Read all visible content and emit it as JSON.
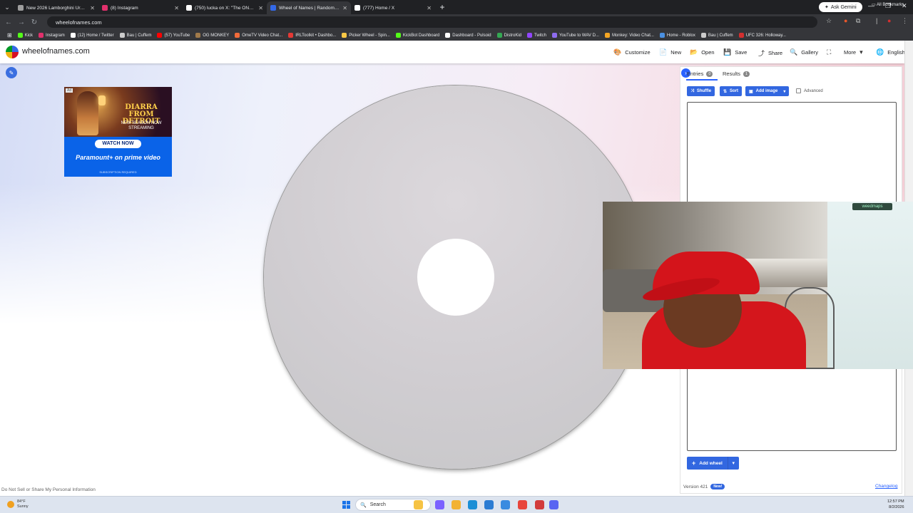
{
  "browser": {
    "tabs": [
      {
        "title": "New 2026 Lamborghini Urus SE",
        "color": "#9e9e9e",
        "active": false
      },
      {
        "title": "(8) Instagram",
        "color": "#e1306c",
        "active": false
      },
      {
        "title": "(750) lucka on X: \"The ONLY thi",
        "color": "#ffffff",
        "active": false
      },
      {
        "title": "Wheel of Names | Random nam",
        "color": "#3369e8",
        "active": true
      },
      {
        "title": "(777) Home / X",
        "color": "#ffffff",
        "active": false
      }
    ],
    "new_tab": "+",
    "gemini_label": "Ask Gemini",
    "url": "wheelofnames.com",
    "bookmarks": [
      {
        "label": "Kick",
        "color": "#53fc18"
      },
      {
        "label": "Instagram",
        "color": "#e1306c"
      },
      {
        "label": "(12) Home / Twitter",
        "color": "#ffffff"
      },
      {
        "label": "Bau | Cuffem",
        "color": "#cccccc"
      },
      {
        "label": "(57) YouTube",
        "color": "#ff0000"
      },
      {
        "label": "OG MONKEY",
        "color": "#a07a4a"
      },
      {
        "label": "OmeTV Video Chat...",
        "color": "#f26b3a"
      },
      {
        "label": "IRLToolkit • Dashbo...",
        "color": "#e53935"
      },
      {
        "label": "Picker Wheel - Spin...",
        "color": "#f9c846"
      },
      {
        "label": "KickBot Dashboard",
        "color": "#53fc18"
      },
      {
        "label": "Dashboard - Pulsoid",
        "color": "#ffffff"
      },
      {
        "label": "DistroKid",
        "color": "#34a853"
      },
      {
        "label": "Twitch",
        "color": "#9146ff"
      },
      {
        "label": "YouTube to WAV D...",
        "color": "#8e6cf0"
      },
      {
        "label": "Monkey: Video Chat...",
        "color": "#f5a623"
      },
      {
        "label": "Home - Roblox",
        "color": "#4a90e2"
      },
      {
        "label": "Bau | Cuffem",
        "color": "#cccccc"
      },
      {
        "label": "UFC 326: Holloway...",
        "color": "#d32f2f"
      }
    ],
    "all_bookmarks": "All Bookmarks"
  },
  "site": {
    "title": "wheelofnames.com",
    "menu": [
      {
        "label": "Customize",
        "icon": "palette-icon",
        "glyph": "🎨"
      },
      {
        "label": "New",
        "icon": "new-file-icon",
        "glyph": "📄"
      },
      {
        "label": "Open",
        "icon": "folder-icon",
        "glyph": "📂"
      },
      {
        "label": "Save",
        "icon": "save-icon",
        "glyph": "💾"
      },
      {
        "label": "Share",
        "icon": "share-icon",
        "glyph": "⤴"
      },
      {
        "label": "Gallery",
        "icon": "search-icon",
        "glyph": "🔍"
      },
      {
        "label": "",
        "icon": "fullscreen-icon",
        "glyph": "⛶"
      },
      {
        "label": "More",
        "icon": "chevron-down-icon",
        "glyph": "▾"
      },
      {
        "label": "English",
        "icon": "globe-icon",
        "glyph": "🌐"
      }
    ],
    "ad": {
      "badge": "Ad",
      "title": "DIARRA FROM DETROIT",
      "subtitle": "NEW SEASON NOW STREAMING",
      "cta": "WATCH NOW",
      "brands": "Paramount+ on prime video",
      "disclaimer": "SUBSCRIPTION REQUIRED"
    },
    "privacy_link": "Do Not Sell or Share My Personal Information"
  },
  "panel": {
    "tabs": [
      {
        "label": "Entries",
        "count": "0"
      },
      {
        "label": "Results",
        "count": "1"
      }
    ],
    "buttons": {
      "shuffle": "Shuffle",
      "sort": "Sort",
      "add_image": "Add image"
    },
    "advanced_label": "Advanced",
    "add_wheel": "Add wheel",
    "version": "Version 421",
    "new_badge": "New!",
    "changelog": "Changelog"
  },
  "webcam": {
    "logo_text": "weedmaps"
  },
  "taskbar": {
    "weather_temp": "84°F",
    "weather_desc": "Sunny",
    "search_placeholder": "Search",
    "time": "12:57 PM",
    "date": "8/2/2026",
    "apps": [
      {
        "name": "file-explorer-icon",
        "color": "#f6c344"
      },
      {
        "name": "copilot-icon",
        "color": "#7b61ff"
      },
      {
        "name": "folder-icon",
        "color": "#f2b233"
      },
      {
        "name": "edge-icon",
        "color": "#1b8fd6"
      },
      {
        "name": "store-icon",
        "color": "#2b7cd3"
      },
      {
        "name": "mail-icon",
        "color": "#3a8be0"
      },
      {
        "name": "chrome-icon",
        "color": "#e8453c"
      },
      {
        "name": "media-icon",
        "color": "#d23b3b"
      },
      {
        "name": "discord-icon",
        "color": "#5865f2"
      }
    ]
  }
}
